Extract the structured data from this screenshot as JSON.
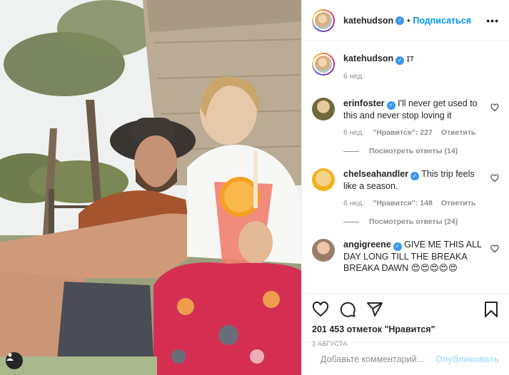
{
  "post": {
    "author": "katehudson",
    "follow_label": "Подписаться",
    "separator": "•",
    "more_label": "•••",
    "caption": {
      "username": "katehudson",
      "text": "ɪт",
      "time": "6 нед."
    },
    "comments": [
      {
        "username": "erinfoster",
        "text": "I'll never get used to this and never stop loving it",
        "time": "6 нед.",
        "likes": "\"Нравится\": 227",
        "reply_label": "Ответить",
        "view_replies": "Посмотреть ответы (14)"
      },
      {
        "username": "chelseahandler",
        "text": "This trip feels like a season.",
        "time": "6 нед.",
        "likes": "\"Нравится\": 148",
        "reply_label": "Ответить",
        "view_replies": "Посмотреть ответы (24)"
      },
      {
        "username": "angigreene",
        "text": "GIVE ME THIS ALL DAY LONG TILL THE BREAKA BREAKA DAWN 😍😍😍😍😍"
      }
    ],
    "likes_total": "201 453 отметок \"Нравится\"",
    "date": "3 АВГУСТА",
    "comment_placeholder": "Добавьте комментарий...",
    "publish_label": "Опубликовать"
  },
  "icons": {
    "like": "heart-icon",
    "comment": "comment-icon",
    "share": "share-icon",
    "save": "bookmark-icon",
    "emoji": "emoji-icon",
    "user_tag": "user-icon"
  },
  "colors": {
    "accent": "#0095f6",
    "verified": "#3897f0",
    "muted": "#8e8e8e",
    "publish_disabled": "#b2dffc"
  }
}
